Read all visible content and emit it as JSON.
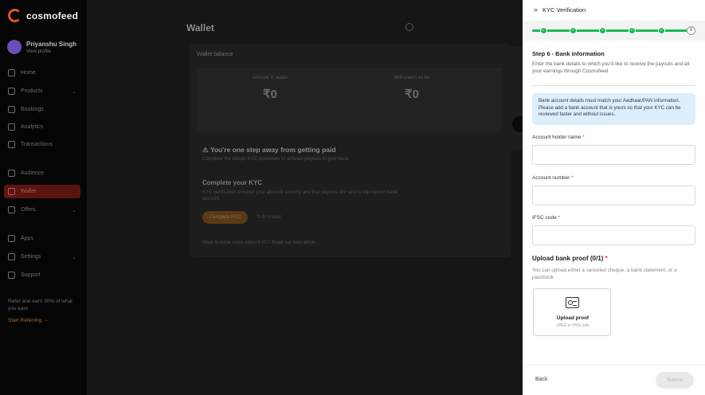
{
  "app": {
    "logo": "cosmofeed"
  },
  "profile": {
    "name": "Priyanshu Singh",
    "sub": "View profile"
  },
  "sidebar": {
    "items": [
      {
        "label": "Home"
      },
      {
        "label": "Products"
      },
      {
        "label": "Bookings"
      },
      {
        "label": "Analytics"
      },
      {
        "label": "Transactions"
      },
      {
        "label": "Audience"
      },
      {
        "label": "Wallet"
      },
      {
        "label": "Offers"
      },
      {
        "label": "Apps"
      },
      {
        "label": "Settings"
      },
      {
        "label": "Support"
      }
    ],
    "promo": "Refer and earn 30% of what you earn",
    "promo_link": "Start Referring →"
  },
  "main": {
    "title": "Wallet",
    "card_label": "Wallet balance",
    "balance_left_label": "Amount in wallet",
    "balance_left_value": "₹0",
    "balance_right_label": "Withdrawn so far",
    "balance_right_value": "₹0",
    "warning": "⚠ You're one step away from getting paid",
    "warning_sub": "Complete the simple KYC procedure to activate payouts to your bank.",
    "kyc_title": "Complete your KYC",
    "kyc_sub": "KYC verification ensures your account security and that payouts are sent to the correct bank account.",
    "kyc_button": "Complete KYC",
    "kyc_link": "I'll do it later",
    "kyc_footer": "Want to know more about KYC? Read our help article."
  },
  "drawer": {
    "title": "KYC Verification",
    "current_step": "6",
    "step_title": "Step 6 - Bank information",
    "step_desc": "Enter the bank details to which you'd like to receive the payouts and all your earnings through Cosmofeed",
    "info": "Bank account details must match your Aadhaar/PAN information. Please add a bank account that is yours so that your KYC can be reviewed faster and without issues.",
    "fields": [
      {
        "label": "Account holder name",
        "value": ""
      },
      {
        "label": "Account number",
        "value": ""
      },
      {
        "label": "IFSC code",
        "value": ""
      }
    ],
    "upload_title": "Upload bank proof (0/1)",
    "upload_desc": "You can upload either a canceled cheque, a bank statement, or a passbook",
    "upload_label": "Upload proof",
    "upload_hint": "JPEG or PNG only",
    "back_label": "Back",
    "submit_label": "Submit",
    "accent": "#1db954"
  }
}
